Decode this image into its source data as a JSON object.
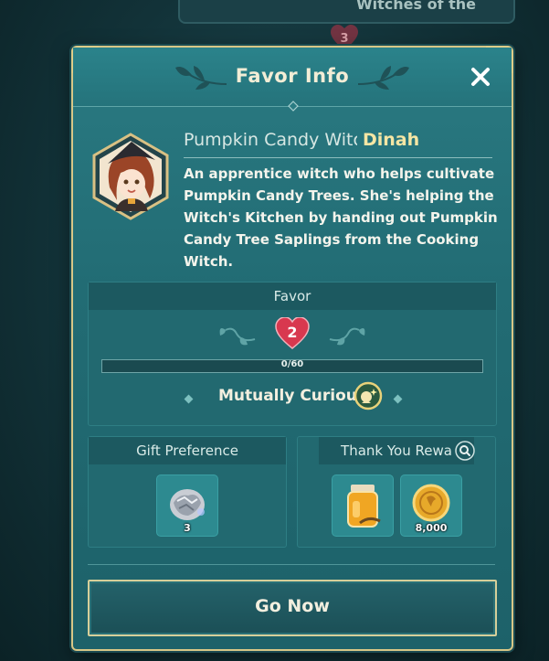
{
  "background": {
    "banner_text": "Witches of the",
    "heart_value": "3"
  },
  "dialog": {
    "title": "Favor Info",
    "close_icon": "close-icon"
  },
  "character": {
    "title": "Pumpkin Candy Witch",
    "name": "Dinah",
    "description": "An apprentice witch who helps cultivate Pumpkin Candy Trees. She's helping the Witch's Kitchen by handing out Pumpkin Candy Tree Saplings from the Cooking Witch."
  },
  "favor": {
    "header": "Favor",
    "level": "2",
    "progress_text": "0/60",
    "progress_fraction": 0,
    "status": "Mutually Curious"
  },
  "gift_preference": {
    "header": "Gift Preference",
    "items": [
      {
        "icon": "silver-ore-icon",
        "count": "3"
      }
    ]
  },
  "thank_you_rewards": {
    "header": "Thank You Rewa",
    "items": [
      {
        "icon": "honey-jar-icon",
        "count": ""
      },
      {
        "icon": "gold-coin-icon",
        "count": "8,000"
      }
    ]
  },
  "actions": {
    "go_now": "Go Now"
  },
  "colors": {
    "panel": "#236f77",
    "gold_border": "#d8c787",
    "heart": "#d8384f"
  }
}
